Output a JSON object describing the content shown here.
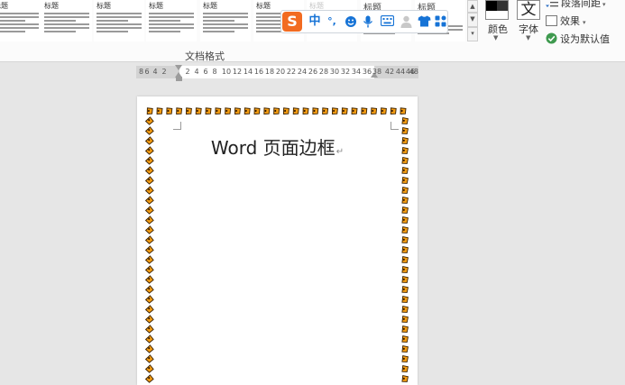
{
  "ribbon": {
    "styles": [
      {
        "title": "标题",
        "emph": false
      },
      {
        "title": "标题",
        "emph": false
      },
      {
        "title": "标题",
        "emph": false
      },
      {
        "title": "标题",
        "emph": false
      },
      {
        "title": "标题",
        "emph": false
      },
      {
        "title": "标题",
        "emph": false
      },
      {
        "title": "标题",
        "emph": false
      },
      {
        "title": "标题",
        "emph": true
      },
      {
        "title": "标题",
        "emph": true
      }
    ],
    "group_caption": "文档格式",
    "colors_label": "颜色",
    "fonts_label": "字体",
    "fonts_glyph": "文",
    "paragraph_spacing_label": "段落间距",
    "effects_label": "效果",
    "set_default_label": "设为默认值"
  },
  "ime_toolbar": {
    "logo": "S",
    "mode": "中",
    "punct": "°,",
    "emoji_icon": "emoji-icon",
    "voice_icon": "microphone-icon",
    "keyboard_icon": "keyboard-icon",
    "user_icon": "user-icon",
    "skin_icon": "shirt-icon",
    "toolbox_icon": "toolbox-icon"
  },
  "ruler": {
    "numbers": [
      "8",
      "6",
      "4",
      "2",
      "2",
      "4",
      "6",
      "8",
      "10",
      "12",
      "14",
      "16",
      "18",
      "20",
      "22",
      "24",
      "26",
      "28",
      "30",
      "32",
      "34",
      "36",
      "38",
      "42",
      "44",
      "46",
      "48"
    ]
  },
  "document": {
    "title": "Word 页面边框",
    "paragraph_mark": "↵"
  },
  "colors": {
    "accent_border": "#f39c12",
    "ime_brand": "#f26b21",
    "ime_blue": "#1673d6"
  }
}
